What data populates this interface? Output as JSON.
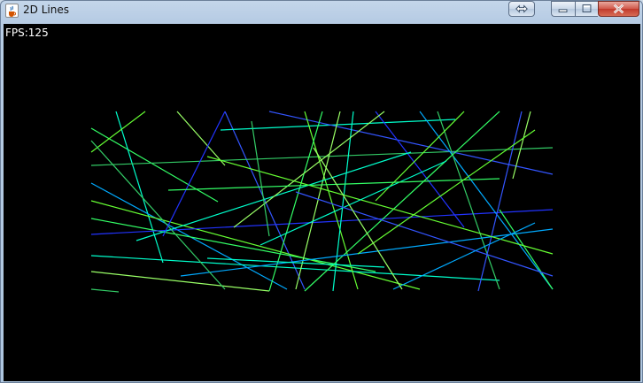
{
  "window": {
    "title": "2D Lines",
    "app_icon": "java-cup-icon",
    "controls": [
      "swap-icon",
      "minimize-icon",
      "maximize-icon",
      "close-icon"
    ]
  },
  "canvas": {
    "fps_label": "FPS:125",
    "background": "#000000",
    "line_colors": [
      "#33ff66",
      "#00ffcc",
      "#3355ff",
      "#66ff33",
      "#2233ff",
      "#33cc66",
      "#00aaff",
      "#99ff66"
    ]
  }
}
